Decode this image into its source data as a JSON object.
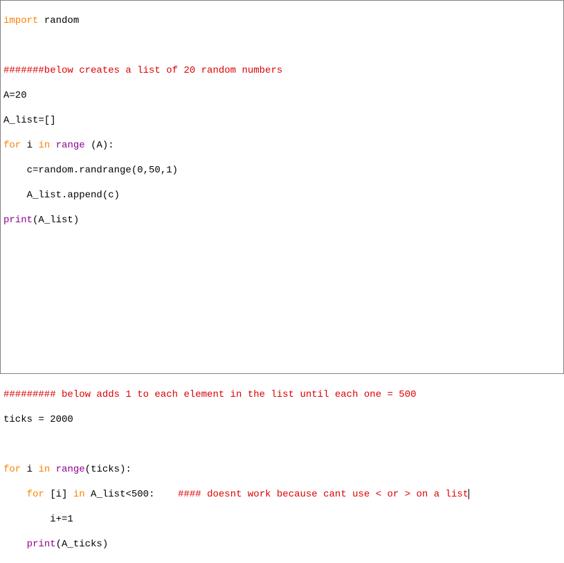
{
  "code": {
    "l1_import": "import",
    "l1_mod": " random",
    "l2": "",
    "l3_comment": "#######below creates a list of 20 random numbers",
    "l4": "A=20",
    "l5": "A_list=[]",
    "l6_for": "for",
    "l6_mid": " i ",
    "l6_in": "in",
    "l6_range": " range",
    "l6_tail": " (A):",
    "l7": "    c=random.randrange(0,50,1)",
    "l8": "    A_list.append(c)",
    "l9_print": "print",
    "l9_tail": "(A_list)",
    "l10": "",
    "l11": "",
    "l12": "",
    "l13": "",
    "l14": "",
    "l15": "",
    "l16_comment": "######### below adds 1 to each element in the list until each one = 500",
    "l17": "ticks = 2000",
    "l18": "",
    "l19_for": "for",
    "l19_mid": " i ",
    "l19_in": "in",
    "l19_range": " range",
    "l19_tail": "(ticks):",
    "l20_indent": "    ",
    "l20_for": "for",
    "l20_mid": " [i] ",
    "l20_in": "in",
    "l20_tail": " A_list<500:    ",
    "l20_comment": "#### doesnt work because cant use < or > on a list",
    "l21": "        i+=1",
    "l22_indent": "    ",
    "l22_print": "print",
    "l22_tail": "(A_ticks)"
  }
}
